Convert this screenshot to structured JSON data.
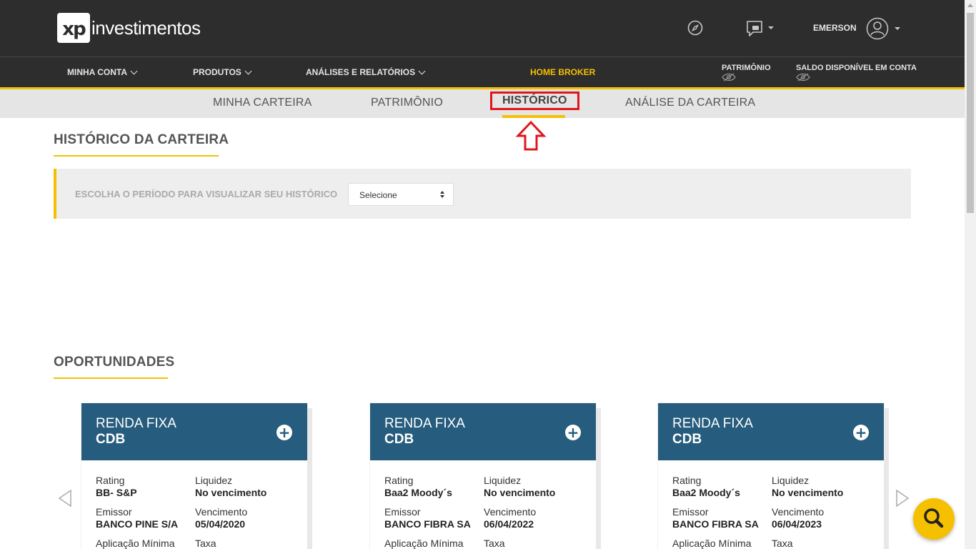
{
  "header": {
    "logo_mark": "xp",
    "logo_text": "investimentos",
    "user_name": "EMERSON",
    "icons": [
      "compass-icon",
      "xp-chat-icon",
      "user-avatar-icon"
    ]
  },
  "nav": {
    "items": [
      {
        "label": "MINHA CONTA",
        "has_dropdown": true
      },
      {
        "label": "PRODUTOS",
        "has_dropdown": true
      },
      {
        "label": "ANÁLISES E RELATÓRIOS",
        "has_dropdown": true
      },
      {
        "label": "HOME BROKER",
        "has_dropdown": false
      }
    ],
    "patrimonio_label": "PATRIMÔNIO",
    "saldo_label": "SALDO DISPONÍVEL EM CONTA"
  },
  "subtabs": [
    {
      "label": "MINHA CARTEIRA",
      "active": false
    },
    {
      "label": "PATRIMÔNIO",
      "active": false
    },
    {
      "label": "HISTÓRICO",
      "active": true
    },
    {
      "label": "ANÁLISE DA CARTEIRA",
      "active": false
    }
  ],
  "history": {
    "title": "HISTÓRICO DA CARTEIRA",
    "filter_label": "ESCOLHA O PERÍODO PARA VISUALIZAR SEU HISTÓRICO",
    "select_value": "Selecione"
  },
  "opportunities": {
    "title": "OPORTUNIDADES",
    "cards": [
      {
        "type": "RENDA FIXA",
        "sub": "CDB",
        "rating_label": "Rating",
        "rating": "BB- S&P",
        "liquidez_label": "Liquidez",
        "liquidez": "No vencimento",
        "emissor_label": "Emissor",
        "emissor": "BANCO PINE S/A",
        "vencimento_label": "Vencimento",
        "vencimento": "05/04/2020",
        "aplicacao_label": "Aplicação Mínima",
        "taxa_label": "Taxa"
      },
      {
        "type": "RENDA FIXA",
        "sub": "CDB",
        "rating_label": "Rating",
        "rating": "Baa2 Moody´s",
        "liquidez_label": "Liquidez",
        "liquidez": "No vencimento",
        "emissor_label": "Emissor",
        "emissor": "BANCO FIBRA SA",
        "vencimento_label": "Vencimento",
        "vencimento": "06/04/2022",
        "aplicacao_label": "Aplicação Mínima",
        "taxa_label": "Taxa"
      },
      {
        "type": "RENDA FIXA",
        "sub": "CDB",
        "rating_label": "Rating",
        "rating": "Baa2 Moody´s",
        "liquidez_label": "Liquidez",
        "liquidez": "No vencimento",
        "emissor_label": "Emissor",
        "emissor": "BANCO FIBRA SA",
        "vencimento_label": "Vencimento",
        "vencimento": "06/04/2023",
        "aplicacao_label": "Aplicação Mínima",
        "taxa_label": "Taxa"
      }
    ]
  },
  "colors": {
    "header_bg": "#2d2d2d",
    "accent_yellow": "#f5c000",
    "card_blue": "#265c7d",
    "highlight_red": "#e3141c"
  }
}
